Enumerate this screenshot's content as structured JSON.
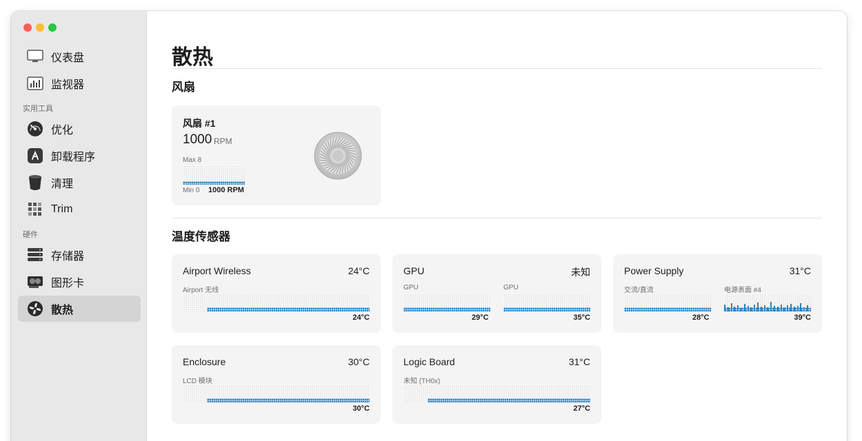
{
  "sidebar": {
    "items": [
      {
        "label": "仪表盘",
        "icon": "monitor-icon"
      },
      {
        "label": "监视器",
        "icon": "activity-chart-icon"
      },
      {
        "label": "优化",
        "icon": "speedometer-icon"
      },
      {
        "label": "卸载程序",
        "icon": "app-store-icon"
      },
      {
        "label": "清理",
        "icon": "trash-bin-icon"
      },
      {
        "label": "Trim",
        "icon": "grid-icon"
      },
      {
        "label": "存储器",
        "icon": "storage-disks-icon"
      },
      {
        "label": "图形卡",
        "icon": "graphics-card-icon"
      },
      {
        "label": "散热",
        "icon": "fan-icon"
      }
    ],
    "sections": {
      "utilities": "实用工具",
      "hardware": "硬件"
    },
    "active": "散热"
  },
  "page": {
    "title": "散热"
  },
  "fans": {
    "section_title": "风扇",
    "card": {
      "name": "风扇 #1",
      "rpm_value": "1000",
      "rpm_unit": "RPM",
      "max_label": "Max 8",
      "min_label": "Min 0",
      "current": "1000 RPM"
    }
  },
  "sensors": {
    "section_title": "温度传感器",
    "cards": [
      {
        "title": "Airport Wireless",
        "value": "24°C",
        "graphs": [
          {
            "label": "Airport 无线",
            "value": "24°C"
          }
        ]
      },
      {
        "title": "GPU",
        "value": "未知",
        "graphs": [
          {
            "label": "GPU",
            "value": "29°C"
          },
          {
            "label": "GPU",
            "value": "35°C"
          }
        ]
      },
      {
        "title": "Power Supply",
        "value": "31°C",
        "graphs": [
          {
            "label": "交流/直流",
            "value": "28°C"
          },
          {
            "label": "电源表面 #4",
            "value": "39°C"
          }
        ]
      },
      {
        "title": "Enclosure",
        "value": "30°C",
        "graphs": [
          {
            "label": "LCD 模块",
            "value": "30°C"
          }
        ]
      },
      {
        "title": "Logic Board",
        "value": "31°C",
        "graphs": [
          {
            "label": "未知 (TH0x)",
            "value": "27°C"
          }
        ]
      }
    ]
  },
  "colors": {
    "accent": "#2b83c4",
    "sidebar_bg": "#e8e8e8",
    "card_bg": "#f4f4f5"
  }
}
